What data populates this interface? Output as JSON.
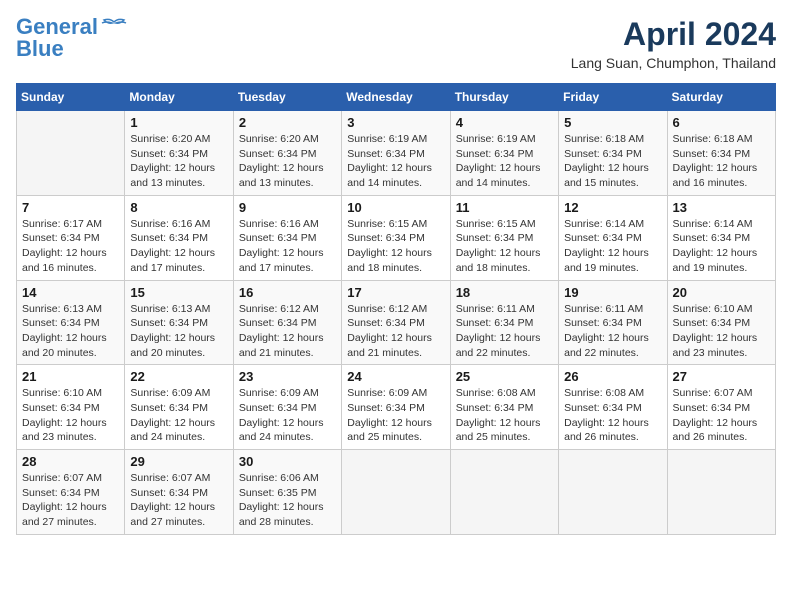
{
  "header": {
    "logo_line1": "General",
    "logo_line2": "Blue",
    "month_title": "April 2024",
    "location": "Lang Suan, Chumphon, Thailand"
  },
  "weekdays": [
    "Sunday",
    "Monday",
    "Tuesday",
    "Wednesday",
    "Thursday",
    "Friday",
    "Saturday"
  ],
  "weeks": [
    [
      {
        "day": "",
        "sunrise": "",
        "sunset": "",
        "daylight": ""
      },
      {
        "day": "1",
        "sunrise": "Sunrise: 6:20 AM",
        "sunset": "Sunset: 6:34 PM",
        "daylight": "Daylight: 12 hours and 13 minutes."
      },
      {
        "day": "2",
        "sunrise": "Sunrise: 6:20 AM",
        "sunset": "Sunset: 6:34 PM",
        "daylight": "Daylight: 12 hours and 13 minutes."
      },
      {
        "day": "3",
        "sunrise": "Sunrise: 6:19 AM",
        "sunset": "Sunset: 6:34 PM",
        "daylight": "Daylight: 12 hours and 14 minutes."
      },
      {
        "day": "4",
        "sunrise": "Sunrise: 6:19 AM",
        "sunset": "Sunset: 6:34 PM",
        "daylight": "Daylight: 12 hours and 14 minutes."
      },
      {
        "day": "5",
        "sunrise": "Sunrise: 6:18 AM",
        "sunset": "Sunset: 6:34 PM",
        "daylight": "Daylight: 12 hours and 15 minutes."
      },
      {
        "day": "6",
        "sunrise": "Sunrise: 6:18 AM",
        "sunset": "Sunset: 6:34 PM",
        "daylight": "Daylight: 12 hours and 16 minutes."
      }
    ],
    [
      {
        "day": "7",
        "sunrise": "Sunrise: 6:17 AM",
        "sunset": "Sunset: 6:34 PM",
        "daylight": "Daylight: 12 hours and 16 minutes."
      },
      {
        "day": "8",
        "sunrise": "Sunrise: 6:16 AM",
        "sunset": "Sunset: 6:34 PM",
        "daylight": "Daylight: 12 hours and 17 minutes."
      },
      {
        "day": "9",
        "sunrise": "Sunrise: 6:16 AM",
        "sunset": "Sunset: 6:34 PM",
        "daylight": "Daylight: 12 hours and 17 minutes."
      },
      {
        "day": "10",
        "sunrise": "Sunrise: 6:15 AM",
        "sunset": "Sunset: 6:34 PM",
        "daylight": "Daylight: 12 hours and 18 minutes."
      },
      {
        "day": "11",
        "sunrise": "Sunrise: 6:15 AM",
        "sunset": "Sunset: 6:34 PM",
        "daylight": "Daylight: 12 hours and 18 minutes."
      },
      {
        "day": "12",
        "sunrise": "Sunrise: 6:14 AM",
        "sunset": "Sunset: 6:34 PM",
        "daylight": "Daylight: 12 hours and 19 minutes."
      },
      {
        "day": "13",
        "sunrise": "Sunrise: 6:14 AM",
        "sunset": "Sunset: 6:34 PM",
        "daylight": "Daylight: 12 hours and 19 minutes."
      }
    ],
    [
      {
        "day": "14",
        "sunrise": "Sunrise: 6:13 AM",
        "sunset": "Sunset: 6:34 PM",
        "daylight": "Daylight: 12 hours and 20 minutes."
      },
      {
        "day": "15",
        "sunrise": "Sunrise: 6:13 AM",
        "sunset": "Sunset: 6:34 PM",
        "daylight": "Daylight: 12 hours and 20 minutes."
      },
      {
        "day": "16",
        "sunrise": "Sunrise: 6:12 AM",
        "sunset": "Sunset: 6:34 PM",
        "daylight": "Daylight: 12 hours and 21 minutes."
      },
      {
        "day": "17",
        "sunrise": "Sunrise: 6:12 AM",
        "sunset": "Sunset: 6:34 PM",
        "daylight": "Daylight: 12 hours and 21 minutes."
      },
      {
        "day": "18",
        "sunrise": "Sunrise: 6:11 AM",
        "sunset": "Sunset: 6:34 PM",
        "daylight": "Daylight: 12 hours and 22 minutes."
      },
      {
        "day": "19",
        "sunrise": "Sunrise: 6:11 AM",
        "sunset": "Sunset: 6:34 PM",
        "daylight": "Daylight: 12 hours and 22 minutes."
      },
      {
        "day": "20",
        "sunrise": "Sunrise: 6:10 AM",
        "sunset": "Sunset: 6:34 PM",
        "daylight": "Daylight: 12 hours and 23 minutes."
      }
    ],
    [
      {
        "day": "21",
        "sunrise": "Sunrise: 6:10 AM",
        "sunset": "Sunset: 6:34 PM",
        "daylight": "Daylight: 12 hours and 23 minutes."
      },
      {
        "day": "22",
        "sunrise": "Sunrise: 6:09 AM",
        "sunset": "Sunset: 6:34 PM",
        "daylight": "Daylight: 12 hours and 24 minutes."
      },
      {
        "day": "23",
        "sunrise": "Sunrise: 6:09 AM",
        "sunset": "Sunset: 6:34 PM",
        "daylight": "Daylight: 12 hours and 24 minutes."
      },
      {
        "day": "24",
        "sunrise": "Sunrise: 6:09 AM",
        "sunset": "Sunset: 6:34 PM",
        "daylight": "Daylight: 12 hours and 25 minutes."
      },
      {
        "day": "25",
        "sunrise": "Sunrise: 6:08 AM",
        "sunset": "Sunset: 6:34 PM",
        "daylight": "Daylight: 12 hours and 25 minutes."
      },
      {
        "day": "26",
        "sunrise": "Sunrise: 6:08 AM",
        "sunset": "Sunset: 6:34 PM",
        "daylight": "Daylight: 12 hours and 26 minutes."
      },
      {
        "day": "27",
        "sunrise": "Sunrise: 6:07 AM",
        "sunset": "Sunset: 6:34 PM",
        "daylight": "Daylight: 12 hours and 26 minutes."
      }
    ],
    [
      {
        "day": "28",
        "sunrise": "Sunrise: 6:07 AM",
        "sunset": "Sunset: 6:34 PM",
        "daylight": "Daylight: 12 hours and 27 minutes."
      },
      {
        "day": "29",
        "sunrise": "Sunrise: 6:07 AM",
        "sunset": "Sunset: 6:34 PM",
        "daylight": "Daylight: 12 hours and 27 minutes."
      },
      {
        "day": "30",
        "sunrise": "Sunrise: 6:06 AM",
        "sunset": "Sunset: 6:35 PM",
        "daylight": "Daylight: 12 hours and 28 minutes."
      },
      {
        "day": "",
        "sunrise": "",
        "sunset": "",
        "daylight": ""
      },
      {
        "day": "",
        "sunrise": "",
        "sunset": "",
        "daylight": ""
      },
      {
        "day": "",
        "sunrise": "",
        "sunset": "",
        "daylight": ""
      },
      {
        "day": "",
        "sunrise": "",
        "sunset": "",
        "daylight": ""
      }
    ]
  ]
}
